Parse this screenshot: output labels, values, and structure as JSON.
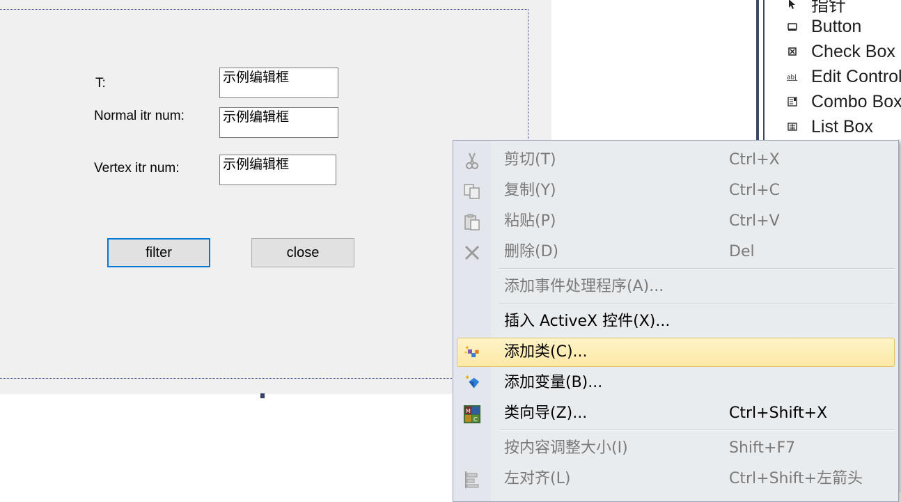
{
  "dialog": {
    "labels": {
      "t": "T:",
      "normal": "Normal itr num:",
      "vertex": "Vertex itr num:"
    },
    "edits": {
      "t_value": "示例编辑框",
      "normal_value": "示例编辑框",
      "vertex_value": "示例编辑框"
    },
    "buttons": {
      "filter": "filter",
      "close": "close"
    }
  },
  "toolbox": {
    "items": [
      {
        "label": "指针",
        "icon": "pointer-icon"
      },
      {
        "label": "Button",
        "icon": "button-icon"
      },
      {
        "label": "Check Box",
        "icon": "checkbox-icon"
      },
      {
        "label": "Edit Control",
        "icon": "edit-control-icon"
      },
      {
        "label": "Combo Box",
        "icon": "combo-box-icon"
      },
      {
        "label": "List Box",
        "icon": "list-box-icon"
      }
    ]
  },
  "context_menu": {
    "items": [
      {
        "label": "剪切(T)",
        "shortcut": "Ctrl+X",
        "icon": "scissors-icon",
        "enabled": false
      },
      {
        "label": "复制(Y)",
        "shortcut": "Ctrl+C",
        "icon": "copy-icon",
        "enabled": false
      },
      {
        "label": "粘贴(P)",
        "shortcut": "Ctrl+V",
        "icon": "paste-icon",
        "enabled": false
      },
      {
        "label": "删除(D)",
        "shortcut": "Del",
        "icon": "delete-icon",
        "enabled": false
      },
      {
        "label": "添加事件处理程序(A)...",
        "shortcut": "",
        "enabled": false
      },
      {
        "label": "插入 ActiveX 控件(X)...",
        "shortcut": "",
        "enabled": true
      },
      {
        "label": "添加类(C)...",
        "shortcut": "",
        "icon": "add-class-icon",
        "enabled": true,
        "highlighted": true
      },
      {
        "label": "添加变量(B)...",
        "shortcut": "",
        "icon": "add-variable-icon",
        "enabled": true
      },
      {
        "label": "类向导(Z)...",
        "shortcut": "Ctrl+Shift+X",
        "icon": "class-wizard-icon",
        "enabled": true
      },
      {
        "label": "按内容调整大小(I)",
        "shortcut": "Shift+F7",
        "enabled": false
      },
      {
        "label": "左对齐(L)",
        "shortcut": "Ctrl+Shift+左箭头",
        "icon": "align-left-icon",
        "enabled": false
      }
    ]
  }
}
